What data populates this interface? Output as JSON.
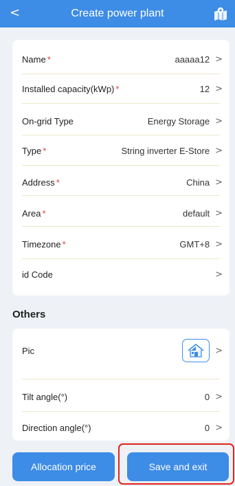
{
  "header": {
    "back_glyph": "<",
    "title": "Create power plant",
    "map_icon": "map-location-icon"
  },
  "required_marker": "*",
  "chevron": ">",
  "fields": [
    {
      "label": "Name",
      "value": "aaaaa12"
    },
    {
      "label": "Installed capacity(kWp)",
      "value": "12"
    },
    {
      "label": "On-grid Type",
      "value": "Energy Storage"
    },
    {
      "label": "Type",
      "value": "String inverter E-Store"
    },
    {
      "label": "Address",
      "value": "China"
    },
    {
      "label": "Area",
      "value": "default"
    },
    {
      "label": "Timezone",
      "value": "GMT+8"
    },
    {
      "label": "id Code",
      "value": ""
    }
  ],
  "others": {
    "title": "Others",
    "pic_label": "Pic",
    "pic_icon": "house-solar-icon",
    "tilt_label": "Tilt angle(°)",
    "tilt_value": "0",
    "direction_label": "Direction angle(°)",
    "direction_value": "0"
  },
  "buttons": {
    "allocation": "Allocation price",
    "save": "Save and exit"
  },
  "colors": {
    "primary": "#3d8ce6",
    "required": "#e53a3a",
    "highlight": "#e2231a",
    "background": "#eef1f6"
  }
}
